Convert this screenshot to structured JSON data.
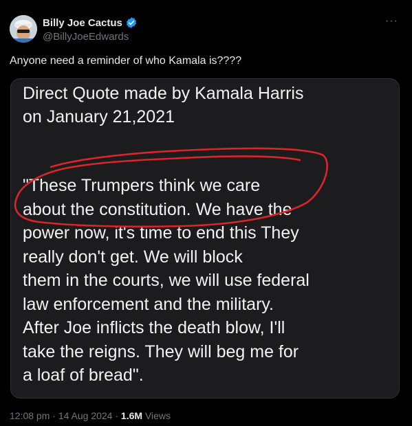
{
  "author": {
    "display_name": "Billy Joe Cactus",
    "handle": "@BillyJoeEdwards",
    "verified": true,
    "avatar_icon": "avatar-photo"
  },
  "more_icon": "ellipsis-icon",
  "tweet": {
    "text": "Anyone need a reminder of who Kamala is????"
  },
  "media": {
    "heading_lines": [
      "Direct Quote made by Kamala Harris",
      "on January 21,2021"
    ],
    "quote_lines": [
      "\"These Trumpers think we care",
      "about the constitution. We have the",
      "power now, it's time to end this They",
      "really don't get. We will block",
      "them in the courts, we will use federal",
      "law enforcement and the military.",
      "After Joe inflicts the death blow, I'll",
      "take the reigns. They will beg me for",
      "a loaf of bread\"."
    ],
    "annotation_color": "#d9262c"
  },
  "meta": {
    "time": "12:08 pm",
    "separator": "·",
    "date": "14 Aug 2024",
    "views_count": "1.6M",
    "views_label": "Views"
  },
  "colors": {
    "background": "#000000",
    "primary_text": "#e7e9ea",
    "secondary_text": "#71767b",
    "verified_badge": "#1d9bf0"
  }
}
